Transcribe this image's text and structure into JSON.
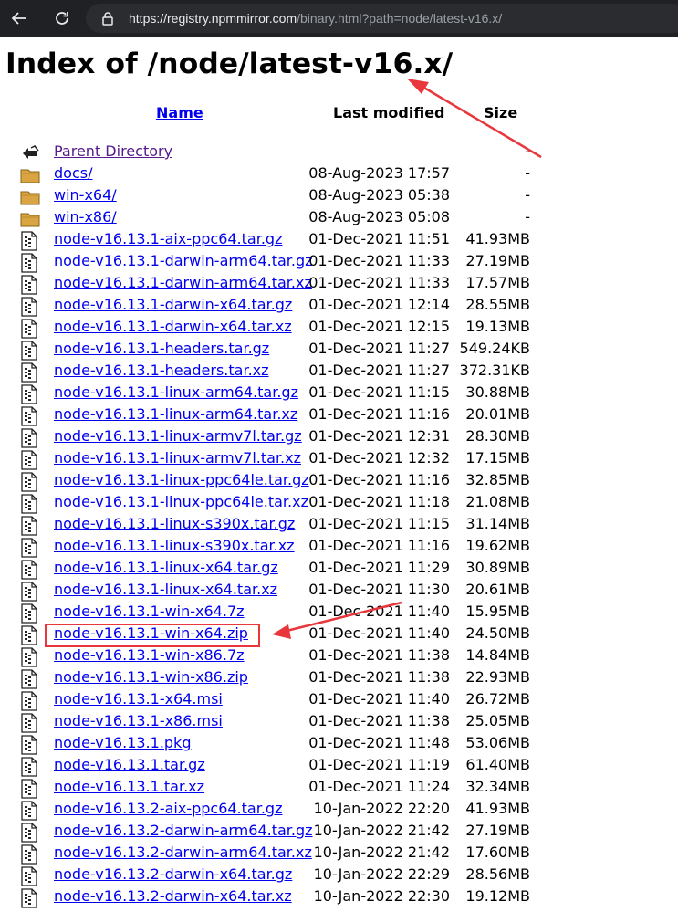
{
  "browser": {
    "url_host": "https://registry.npmmirror.com",
    "url_path": "/binary.html?path=node/latest-v16.x/"
  },
  "page": {
    "title": "Index of /node/latest-v16.x/",
    "headers": {
      "name": "Name",
      "last_modified": "Last modified",
      "size": "Size"
    }
  },
  "rows": [
    {
      "name": "Parent Directory",
      "modified": "",
      "size": "-",
      "icon": "back-icon"
    },
    {
      "name": "docs/",
      "modified": "08-Aug-2023 17:57",
      "size": "-",
      "icon": "folder-icon"
    },
    {
      "name": "win-x64/",
      "modified": "08-Aug-2023 05:38",
      "size": "-",
      "icon": "folder-icon"
    },
    {
      "name": "win-x86/",
      "modified": "08-Aug-2023 05:08",
      "size": "-",
      "icon": "folder-icon"
    },
    {
      "name": "node-v16.13.1-aix-ppc64.tar.gz",
      "modified": "01-Dec-2021 11:51",
      "size": "41.93MB",
      "icon": "file-icon"
    },
    {
      "name": "node-v16.13.1-darwin-arm64.tar.gz",
      "modified": "01-Dec-2021 11:33",
      "size": "27.19MB",
      "icon": "file-icon"
    },
    {
      "name": "node-v16.13.1-darwin-arm64.tar.xz",
      "modified": "01-Dec-2021 11:33",
      "size": "17.57MB",
      "icon": "file-icon"
    },
    {
      "name": "node-v16.13.1-darwin-x64.tar.gz",
      "modified": "01-Dec-2021 12:14",
      "size": "28.55MB",
      "icon": "file-icon"
    },
    {
      "name": "node-v16.13.1-darwin-x64.tar.xz",
      "modified": "01-Dec-2021 12:15",
      "size": "19.13MB",
      "icon": "file-icon"
    },
    {
      "name": "node-v16.13.1-headers.tar.gz",
      "modified": "01-Dec-2021 11:27",
      "size": "549.24KB",
      "icon": "file-icon"
    },
    {
      "name": "node-v16.13.1-headers.tar.xz",
      "modified": "01-Dec-2021 11:27",
      "size": "372.31KB",
      "icon": "file-icon"
    },
    {
      "name": "node-v16.13.1-linux-arm64.tar.gz",
      "modified": "01-Dec-2021 11:15",
      "size": "30.88MB",
      "icon": "file-icon"
    },
    {
      "name": "node-v16.13.1-linux-arm64.tar.xz",
      "modified": "01-Dec-2021 11:16",
      "size": "20.01MB",
      "icon": "file-icon"
    },
    {
      "name": "node-v16.13.1-linux-armv7l.tar.gz",
      "modified": "01-Dec-2021 12:31",
      "size": "28.30MB",
      "icon": "file-icon"
    },
    {
      "name": "node-v16.13.1-linux-armv7l.tar.xz",
      "modified": "01-Dec-2021 12:32",
      "size": "17.15MB",
      "icon": "file-icon"
    },
    {
      "name": "node-v16.13.1-linux-ppc64le.tar.gz",
      "modified": "01-Dec-2021 11:16",
      "size": "32.85MB",
      "icon": "file-icon"
    },
    {
      "name": "node-v16.13.1-linux-ppc64le.tar.xz",
      "modified": "01-Dec-2021 11:18",
      "size": "21.08MB",
      "icon": "file-icon"
    },
    {
      "name": "node-v16.13.1-linux-s390x.tar.gz",
      "modified": "01-Dec-2021 11:15",
      "size": "31.14MB",
      "icon": "file-icon"
    },
    {
      "name": "node-v16.13.1-linux-s390x.tar.xz",
      "modified": "01-Dec-2021 11:16",
      "size": "19.62MB",
      "icon": "file-icon"
    },
    {
      "name": "node-v16.13.1-linux-x64.tar.gz",
      "modified": "01-Dec-2021 11:29",
      "size": "30.89MB",
      "icon": "file-icon"
    },
    {
      "name": "node-v16.13.1-linux-x64.tar.xz",
      "modified": "01-Dec-2021 11:30",
      "size": "20.61MB",
      "icon": "file-icon"
    },
    {
      "name": "node-v16.13.1-win-x64.7z",
      "modified": "01-Dec-2021 11:40",
      "size": "15.95MB",
      "icon": "file-icon"
    },
    {
      "name": "node-v16.13.1-win-x64.zip",
      "modified": "01-Dec-2021 11:40",
      "size": "24.50MB",
      "icon": "file-icon",
      "highlighted": true
    },
    {
      "name": "node-v16.13.1-win-x86.7z",
      "modified": "01-Dec-2021 11:38",
      "size": "14.84MB",
      "icon": "file-icon"
    },
    {
      "name": "node-v16.13.1-win-x86.zip",
      "modified": "01-Dec-2021 11:38",
      "size": "22.93MB",
      "icon": "file-icon"
    },
    {
      "name": "node-v16.13.1-x64.msi",
      "modified": "01-Dec-2021 11:40",
      "size": "26.72MB",
      "icon": "file-icon"
    },
    {
      "name": "node-v16.13.1-x86.msi",
      "modified": "01-Dec-2021 11:38",
      "size": "25.05MB",
      "icon": "file-icon"
    },
    {
      "name": "node-v16.13.1.pkg",
      "modified": "01-Dec-2021 11:48",
      "size": "53.06MB",
      "icon": "file-icon"
    },
    {
      "name": "node-v16.13.1.tar.gz",
      "modified": "01-Dec-2021 11:19",
      "size": "61.40MB",
      "icon": "file-icon"
    },
    {
      "name": "node-v16.13.1.tar.xz",
      "modified": "01-Dec-2021 11:24",
      "size": "32.34MB",
      "icon": "file-icon"
    },
    {
      "name": "node-v16.13.2-aix-ppc64.tar.gz",
      "modified": "10-Jan-2022 22:20",
      "size": "41.93MB",
      "icon": "file-icon"
    },
    {
      "name": "node-v16.13.2-darwin-arm64.tar.gz",
      "modified": "10-Jan-2022 21:42",
      "size": "27.19MB",
      "icon": "file-icon"
    },
    {
      "name": "node-v16.13.2-darwin-arm64.tar.xz",
      "modified": "10-Jan-2022 21:42",
      "size": "17.60MB",
      "icon": "file-icon"
    },
    {
      "name": "node-v16.13.2-darwin-x64.tar.gz",
      "modified": "10-Jan-2022 22:29",
      "size": "28.56MB",
      "icon": "file-icon"
    },
    {
      "name": "node-v16.13.2-darwin-x64.tar.xz",
      "modified": "10-Jan-2022 22:30",
      "size": "19.12MB",
      "icon": "file-icon"
    }
  ],
  "annotation_color": "#e8383d"
}
